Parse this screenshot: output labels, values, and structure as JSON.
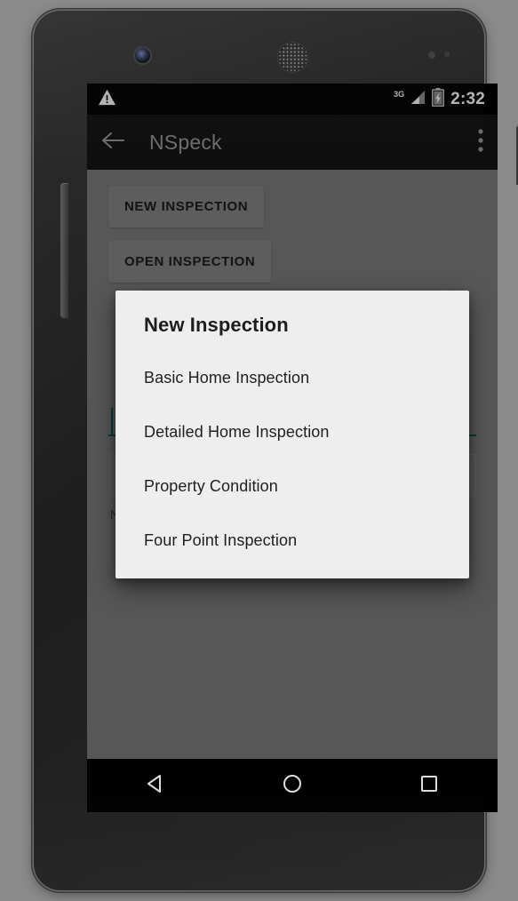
{
  "device": {
    "hardware": {
      "front_camera": "front-camera",
      "earpiece": "earpiece-speaker",
      "proximity_sensor": "proximity-sensor",
      "light_sensor": "light-sensor",
      "volume_button": "volume-button",
      "power_button": "power-button"
    }
  },
  "status_bar": {
    "warning_icon": "warning-triangle-icon",
    "network_type": "3G",
    "signal_icon": "signal-bars-icon",
    "battery_icon": "battery-charging-icon",
    "time": "2:32",
    "background_color": "#000000"
  },
  "app_bar": {
    "back_icon": "back-arrow-icon",
    "title": "NSpeck",
    "overflow_icon": "overflow-menu-icon",
    "background_color": "#151515",
    "title_color": "#9b9b9b"
  },
  "content": {
    "buttons": [
      {
        "label": "NEW INSPECTION",
        "name": "new-inspection-button"
      },
      {
        "label": "OPEN INSPECTION",
        "name": "open-inspection-button"
      }
    ],
    "text_field": {
      "value": "",
      "accent_color": "#0b5a53",
      "name": "inspection-name-input"
    },
    "helper_text": "N",
    "background_color": "#7d7d7d"
  },
  "dialog": {
    "title": "New Inspection",
    "background_color": "#eeeeee",
    "options": [
      {
        "label": "Basic Home Inspection",
        "name": "dialog-option-basic-home-inspection"
      },
      {
        "label": "Detailed Home Inspection",
        "name": "dialog-option-detailed-home-inspection"
      },
      {
        "label": "Property Condition",
        "name": "dialog-option-property-condition"
      },
      {
        "label": "Four Point Inspection",
        "name": "dialog-option-four-point-inspection"
      }
    ]
  },
  "nav_bar": {
    "background_color": "#000000",
    "buttons": [
      {
        "name": "nav-back-button",
        "icon": "triangle-back-icon"
      },
      {
        "name": "nav-home-button",
        "icon": "circle-home-icon"
      },
      {
        "name": "nav-recents-button",
        "icon": "square-recents-icon"
      }
    ]
  }
}
